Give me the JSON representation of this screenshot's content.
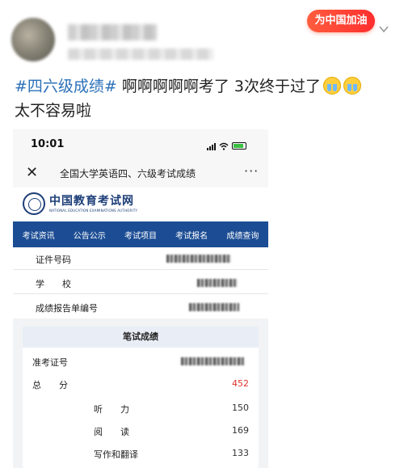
{
  "post": {
    "badge_label": "为中国加油",
    "hashtag": "#四六级成绩#",
    "text_line1": " 啊啊啊啊啊考了 3次终于过了",
    "text_line2": "太不容易啦",
    "emoji": "crying-face-icon"
  },
  "phone": {
    "time": "10:01",
    "page_title": "全国大学英语四、六级考试成绩",
    "site_logo_cn": "中国教育考试网",
    "site_logo_en": "NATIONAL EDUCATION EXAMINATIONS AUTHORITY",
    "nav": [
      "考试资讯",
      "公告公示",
      "考试项目",
      "考试报名",
      "成绩查询"
    ],
    "info_labels": {
      "id_number": "证件号码",
      "school": "学　　校",
      "report_number": "成绩报告单编号"
    },
    "score": {
      "heading": "笔试成绩",
      "ticket_label": "准考证号",
      "total_label": "总　　分",
      "total_value": "452",
      "listening_label": "听　　力",
      "listening_value": "150",
      "reading_label": "阅　　读",
      "reading_value": "169",
      "writing_label": "写作和翻译",
      "writing_value": "133"
    }
  },
  "colors": {
    "hashtag": "#2c71b8",
    "nav_bg": "#1c4d94",
    "total_score": "#e0332a",
    "badge": "#ff3b2f"
  }
}
